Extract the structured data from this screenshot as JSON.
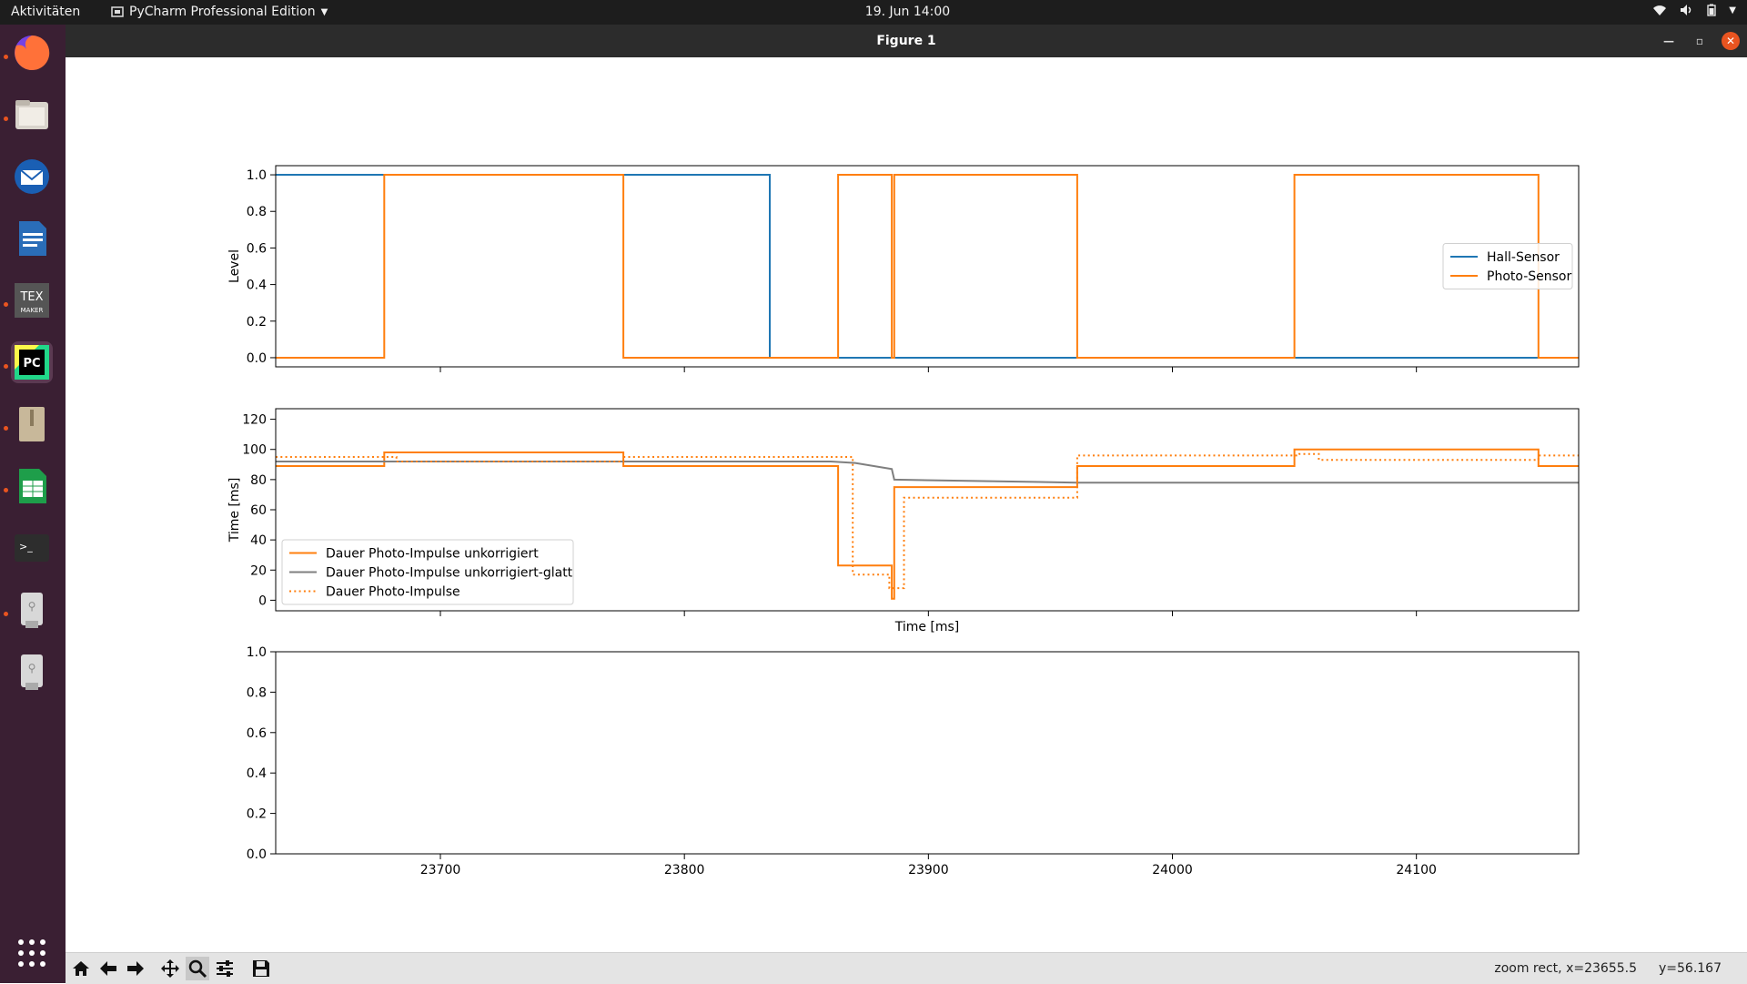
{
  "topbar": {
    "activities": "Aktivitäten",
    "app_name": "PyCharm Professional Edition",
    "clock": "19. Jun  14:00"
  },
  "dock": {
    "items": [
      "firefox-icon",
      "files-icon",
      "thunderbird-icon",
      "writer-icon",
      "texmaker-icon",
      "pycharm-icon",
      "archive-icon",
      "calc-icon",
      "terminal-icon",
      "usb-drive-icon",
      "usb-drive-icon",
      "app-grid-icon"
    ]
  },
  "window": {
    "title": "Figure 1"
  },
  "toolbar": {
    "status_mode": "zoom rect, x=23655.5",
    "status_y": "y=56.167"
  },
  "chart_data": [
    {
      "type": "line",
      "ylabel": "Level",
      "xlim": [
        23632.5,
        24166.5
      ],
      "ylim": [
        -0.05,
        1.05
      ],
      "yticks": [
        "0.0",
        "0.2",
        "0.4",
        "0.6",
        "0.8",
        "1.0"
      ],
      "legend_loc": "center-right",
      "series": [
        {
          "name": "Hall-Sensor",
          "color": "#1f77b4",
          "style": "solid",
          "x": [
            23632.5,
            23835,
            23835,
            24166.5
          ],
          "y": [
            1,
            1,
            0,
            0
          ]
        },
        {
          "name": "Photo-Sensor",
          "color": "#ff7f0e",
          "style": "solid",
          "x": [
            23632.5,
            23677,
            23677,
            23775,
            23775,
            23863,
            23863,
            23885,
            23885,
            23886,
            23886,
            23961,
            23961,
            24050,
            24050,
            24150,
            24150,
            24166.5
          ],
          "y": [
            0,
            0,
            1,
            1,
            0,
            0,
            1,
            1,
            0,
            0,
            1,
            1,
            0,
            0,
            1,
            1,
            0,
            0
          ]
        }
      ]
    },
    {
      "type": "line",
      "ylabel": "Time [ms]",
      "xlabel": "Time [ms]",
      "xlim": [
        23632.5,
        24166.5
      ],
      "ylim": [
        -7,
        127
      ],
      "yticks": [
        "0",
        "20",
        "40",
        "60",
        "80",
        "100",
        "120"
      ],
      "legend_loc": "lower-left",
      "series": [
        {
          "name": "Dauer Photo-Impulse unkorrigiert",
          "color": "#ff7f0e",
          "style": "solid",
          "x": [
            23632.5,
            23677,
            23677,
            23775,
            23775,
            23863,
            23863,
            23885,
            23885,
            23886,
            23886,
            23961,
            23961,
            24050,
            24050,
            24150,
            24150,
            24166.5
          ],
          "y": [
            89,
            89,
            98,
            98,
            89,
            89,
            23,
            23,
            1,
            1,
            75,
            75,
            89,
            89,
            100,
            100,
            89,
            89
          ]
        },
        {
          "name": "Dauer Photo-Impulse unkorrigiert-glatt",
          "color": "#7f7f7f",
          "style": "solid",
          "x": [
            23632.5,
            23860,
            23870,
            23885,
            23886,
            23961,
            24166.5
          ],
          "y": [
            92,
            92,
            91,
            87,
            80,
            78,
            78
          ]
        },
        {
          "name": "Dauer Photo-Impulse",
          "color": "#ff7f0e",
          "style": "dotted",
          "x": [
            23632.5,
            23682,
            23682,
            23775,
            23775,
            23869,
            23869,
            23884,
            23884,
            23890,
            23890,
            23961,
            23961,
            24052,
            24052,
            24060,
            24060,
            24150,
            24150,
            24166.5
          ],
          "y": [
            95,
            95,
            92,
            92,
            95,
            95,
            17,
            17,
            8,
            8,
            68,
            68,
            96,
            96,
            97,
            97,
            93,
            93,
            96,
            96
          ]
        }
      ]
    },
    {
      "type": "line",
      "xlim": [
        23632.5,
        24166.5
      ],
      "ylim": [
        0,
        1
      ],
      "xticks": [
        "23700",
        "23800",
        "23900",
        "24000",
        "24100"
      ],
      "yticks": [
        "0.0",
        "0.2",
        "0.4",
        "0.6",
        "0.8",
        "1.0"
      ],
      "series": []
    }
  ]
}
